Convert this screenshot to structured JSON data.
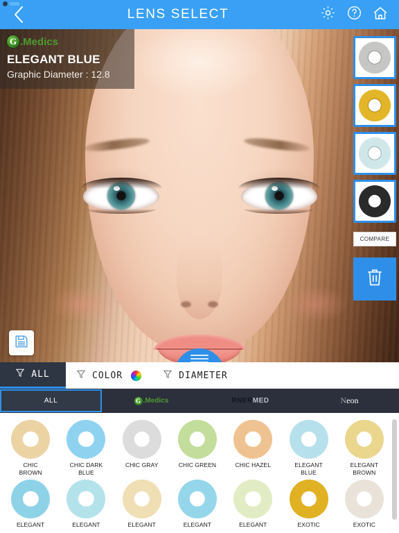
{
  "topbar": {
    "title": "LENS SELECT",
    "back_icon": "chevron-left-icon",
    "settings_icon": "gear-icon",
    "help_icon": "question-circle-icon",
    "home_icon": "home-icon",
    "background_color": "#39a0f5"
  },
  "overlay": {
    "brand_mark": "G",
    "brand_name": ".Medics",
    "lens_name": "ELEGANT BLUE",
    "diameter_text": "Graphic Diameter : 12.8",
    "brand_color": "#4e9a2f"
  },
  "stage": {
    "save_icon": "floppy-save-icon",
    "drag_handle_icon": "hamburger-drag-icon"
  },
  "rail": {
    "thumbnails": [
      {
        "name": "lens-thumb-gray",
        "color": "#c6c6c4",
        "ring": "#5f5f5c"
      },
      {
        "name": "lens-thumb-gold",
        "color": "#e3b528",
        "ring": "#6b4f10"
      },
      {
        "name": "lens-thumb-aqua",
        "color": "#cfe7e8",
        "ring": "#3d5f5e"
      },
      {
        "name": "lens-thumb-black",
        "color": "#2a2a2a",
        "ring": "#0d0d0d"
      }
    ],
    "compare_label": "COMPARE",
    "delete_icon": "trash-icon",
    "accent_color": "#2f8fe8"
  },
  "filters": [
    {
      "label": "ALL",
      "icon": "funnel-icon",
      "active": true,
      "swatch": false
    },
    {
      "label": "COLOR",
      "icon": "funnel-icon",
      "active": false,
      "swatch": true
    },
    {
      "label": "DIAMETER",
      "icon": "funnel-icon",
      "active": false,
      "swatch": false
    }
  ],
  "brand_tabs": [
    {
      "label": "ALL",
      "type": "text",
      "active": true
    },
    {
      "label": ".Medics",
      "type": "gmedics",
      "active": false
    },
    {
      "label": "RNERMED",
      "type": "rnermed",
      "active": false
    },
    {
      "label": "Neon",
      "type": "neon",
      "active": false
    }
  ],
  "lens_grid": [
    {
      "label": "CHIC\nBROWN",
      "color": "#ecd3a4",
      "ring": "#4c4a45"
    },
    {
      "label": "CHIC DARK\nBLUE",
      "color": "#8ed2f0",
      "ring": "#4c4a45"
    },
    {
      "label": "CHIC GRAY",
      "color": "#dcdcdc",
      "ring": "#4c4a45"
    },
    {
      "label": "CHIC GREEN",
      "color": "#c3dd9c",
      "ring": "#4c4a45"
    },
    {
      "label": "CHIC HAZEL",
      "color": "#efc391",
      "ring": "#4c4a45"
    },
    {
      "label": "ELEGANT\nBLUE",
      "color": "#b6e1ec",
      "ring": "#4c4a45"
    },
    {
      "label": "ELEGANT\nBROWN",
      "color": "#ead68c",
      "ring": "#4c4a45"
    },
    {
      "label": "ELEGANT",
      "color": "#8ed2e8",
      "ring": "#55585a"
    },
    {
      "label": "ELEGANT",
      "color": "#b3e2ea",
      "ring": "#55585a"
    },
    {
      "label": "ELEGANT",
      "color": "#f0dfb4",
      "ring": "#55585a"
    },
    {
      "label": "ELEGANT",
      "color": "#96d6ea",
      "ring": "#55585a"
    },
    {
      "label": "ELEGANT",
      "color": "#e2ecc4",
      "ring": "#55585a"
    },
    {
      "label": "EXOTIC",
      "color": "#e0b223",
      "ring": "#4a3309"
    },
    {
      "label": "EXOTIC",
      "color": "#e8e2d8",
      "ring": "#4d3520"
    }
  ]
}
